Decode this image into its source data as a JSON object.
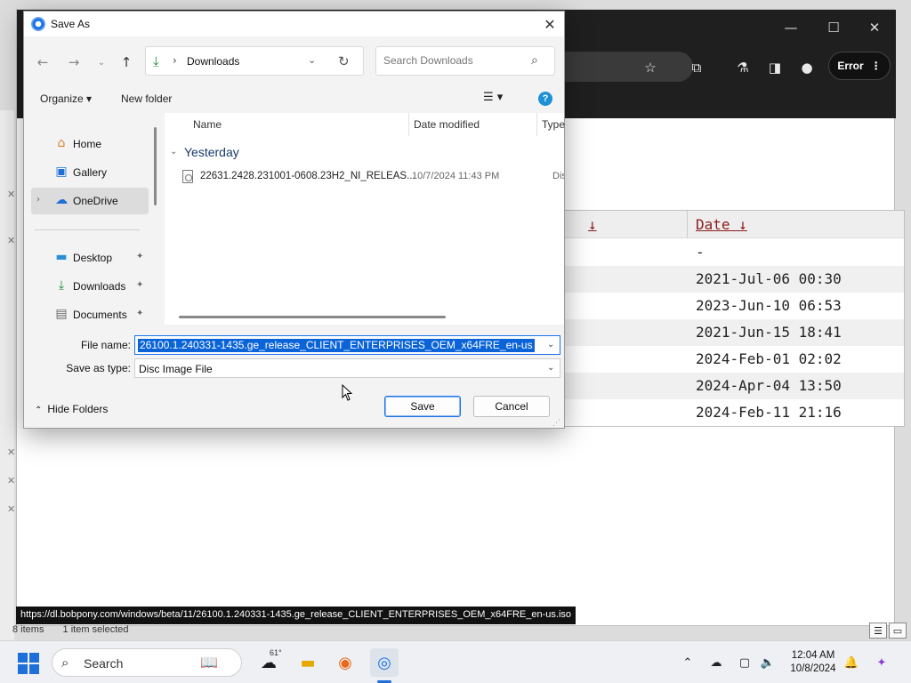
{
  "browser": {
    "toolbar": {
      "profile_error_label": "Error"
    },
    "table": {
      "header_cols": [
        "↓",
        "Date ↓"
      ],
      "dates": [
        "-",
        "2021-Jul-06 00:30",
        "2023-Jun-10 06:53",
        "2021-Jun-15 18:41",
        "2024-Feb-01 02:02",
        "2024-Apr-04 13:50",
        "2024-Feb-11 21:16"
      ]
    },
    "status_url": "https://dl.bobpony.com/windows/beta/11/26100.1.240331-1435.ge_release_CLIENT_ENTERPRISES_OEM_x64FRE_en-us.iso"
  },
  "explorer_status": {
    "items": "8 items",
    "selected": "1 item selected"
  },
  "dialog": {
    "title": "Save As",
    "address": {
      "location": "Downloads"
    },
    "search": {
      "placeholder": "Search Downloads"
    },
    "commands": {
      "organize": "Organize ▾",
      "new_folder": "New folder"
    },
    "nav": {
      "items": [
        {
          "label": "Home",
          "icon": "home-icon"
        },
        {
          "label": "Gallery",
          "icon": "gallery-icon"
        },
        {
          "label": "OneDrive",
          "icon": "cloud-icon",
          "selected": true
        },
        {
          "label": "Desktop",
          "icon": "desktop-icon",
          "pinned": true
        },
        {
          "label": "Downloads",
          "icon": "download-icon",
          "pinned": true
        },
        {
          "label": "Documents",
          "icon": "document-icon",
          "pinned": true
        }
      ]
    },
    "columns": {
      "name": "Name",
      "date": "Date modified",
      "type": "Type"
    },
    "group": "Yesterday",
    "files": [
      {
        "name": "22631.2428.231001-0608.23H2_NI_RELEAS...",
        "date": "10/7/2024 11:43 PM",
        "type": "Disc I"
      }
    ],
    "filename_label": "File name:",
    "filename_value": "26100.1.240331-1435.ge_release_CLIENT_ENTERPRISES_OEM_x64FRE_en-us",
    "savetype_label": "Save as type:",
    "savetype_value": "Disc Image File",
    "hide_folders": "Hide Folders",
    "save_label": "Save",
    "cancel_label": "Cancel"
  },
  "taskbar": {
    "search_label": "Search",
    "weather_temp": "61°",
    "time": "12:04 AM",
    "date": "10/8/2024"
  },
  "colors": {
    "accent": "#1a73e8",
    "selection": "#0a64d8",
    "link_red": "#8b1a1a"
  }
}
